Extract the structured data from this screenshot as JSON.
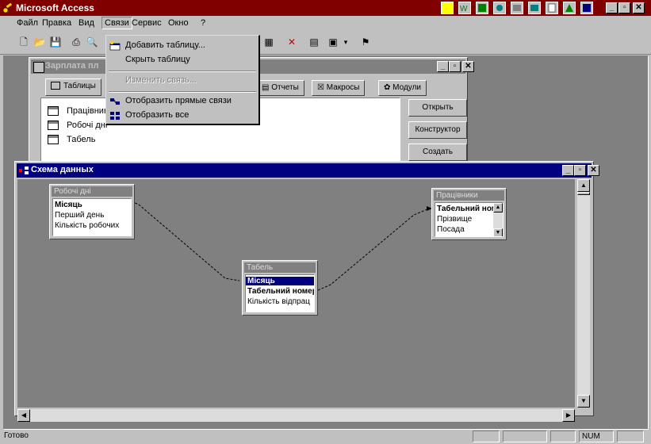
{
  "app": {
    "title": "Microsoft Access",
    "window_buttons": [
      "_",
      "▫",
      "✕"
    ]
  },
  "menubar": {
    "items": [
      "Файл",
      "Правка",
      "Вид",
      "Связи",
      "Сервис",
      "Окно",
      "?"
    ]
  },
  "menu_dropdown": {
    "items": [
      {
        "label": "Добавить таблицу...",
        "enabled": true,
        "icon": "add-table-icon"
      },
      {
        "label": "Скрыть таблицу",
        "enabled": true,
        "icon": ""
      },
      {
        "label": "Изменить связь...",
        "enabled": false,
        "icon": ""
      },
      {
        "label": "Отобразить прямые связи",
        "enabled": true,
        "icon": "direct-links-icon"
      },
      {
        "label": "Отобразить все",
        "enabled": true,
        "icon": "show-all-icon"
      }
    ]
  },
  "db_window": {
    "title": "Зарплата пл",
    "tabs": [
      "Таблицы",
      "Отчеты",
      "Макросы",
      "Модули"
    ],
    "tables": [
      "Працівники",
      "Робочі дні",
      "Табель"
    ],
    "buttons": [
      "Открыть",
      "Конструктор",
      "Создать"
    ]
  },
  "schema_window": {
    "title": "Схема данных",
    "tables": [
      {
        "name": "Робочі дні",
        "fields": [
          "Місяць",
          "Перший день",
          "Кількість робочих"
        ],
        "key_fields": [
          0
        ]
      },
      {
        "name": "Табель",
        "fields": [
          "Місяць",
          "Табельний номер",
          "Кількість відпрац"
        ],
        "key_fields": [
          0,
          1
        ],
        "selected": 0
      },
      {
        "name": "Працівники",
        "fields": [
          "Табельний номер",
          "Прізвище",
          "Посада"
        ],
        "key_fields": [
          0
        ]
      }
    ]
  },
  "statusbar": {
    "text": "Готово",
    "indicators": [
      "NUM"
    ]
  },
  "colors": {
    "app_title": "#800000",
    "active_title": "#000080",
    "inactive_title": "#808080",
    "face": "#c0c0c0"
  }
}
